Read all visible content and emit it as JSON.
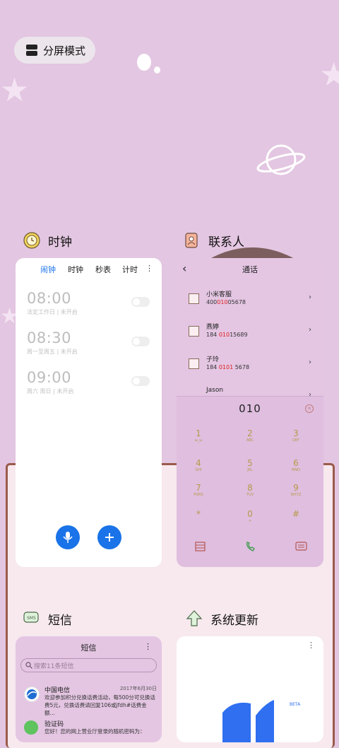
{
  "split_button": {
    "label": "分屏模式",
    "icon": "split-screen-icon"
  },
  "clock_app": {
    "name": "时钟",
    "tabs": [
      "闹钟",
      "时钟",
      "秒表",
      "计时"
    ],
    "more": "⋮",
    "alarms": [
      {
        "time": "08:00",
        "detail": "法定工作日 | 未开启"
      },
      {
        "time": "08:30",
        "detail": "周一至周五 | 未开启"
      },
      {
        "time": "09:00",
        "detail": "周六 周日 | 未开启"
      }
    ],
    "colors": {
      "accent": "#1a73e8"
    }
  },
  "contacts_app": {
    "name": "联系人",
    "header_title": "通话",
    "back": "‹",
    "contacts": [
      {
        "name": "小米客服",
        "num_pre": "400",
        "num_hl": "010",
        "num_post": "05678"
      },
      {
        "name": "燕婷",
        "num_pre": "184 ",
        "num_hl": "010",
        "num_post": "15689"
      },
      {
        "name": "子玲",
        "num_pre": "184 ",
        "num_hl": "0101",
        "num_post": " 5678"
      },
      {
        "name": "Jason",
        "num_pre": "",
        "num_hl": "",
        "num_post": ""
      }
    ],
    "dial_display": "010",
    "keys": [
      {
        "d": "1",
        "l": "ω_ω"
      },
      {
        "d": "2",
        "l": "ABC"
      },
      {
        "d": "3",
        "l": "DEF"
      },
      {
        "d": "4",
        "l": "GHI"
      },
      {
        "d": "5",
        "l": "JKL"
      },
      {
        "d": "6",
        "l": "MNO"
      },
      {
        "d": "7",
        "l": "PQRS"
      },
      {
        "d": "8",
        "l": "TUV"
      },
      {
        "d": "9",
        "l": "WXYZ"
      },
      {
        "d": "*",
        "l": ""
      },
      {
        "d": "0",
        "l": "+"
      },
      {
        "d": "#",
        "l": ""
      }
    ]
  },
  "messages_app": {
    "name": "短信",
    "title": "短信",
    "more": "⋮",
    "search_placeholder": "搜索11条短信",
    "items": [
      {
        "sender": "中国电信",
        "date": "2017年6月30日",
        "text": "欢迎参加积分兑换话费活动，每500分可兑换话费5元，兑换话费请回复106或jfdh#话费金额…"
      },
      {
        "sender": "验证码",
        "date": "",
        "text": "您好！您的网上营业厅登录的随机密码为："
      }
    ]
  },
  "update_app": {
    "name": "系统更新",
    "badge": "BETA",
    "more": "⋮"
  }
}
